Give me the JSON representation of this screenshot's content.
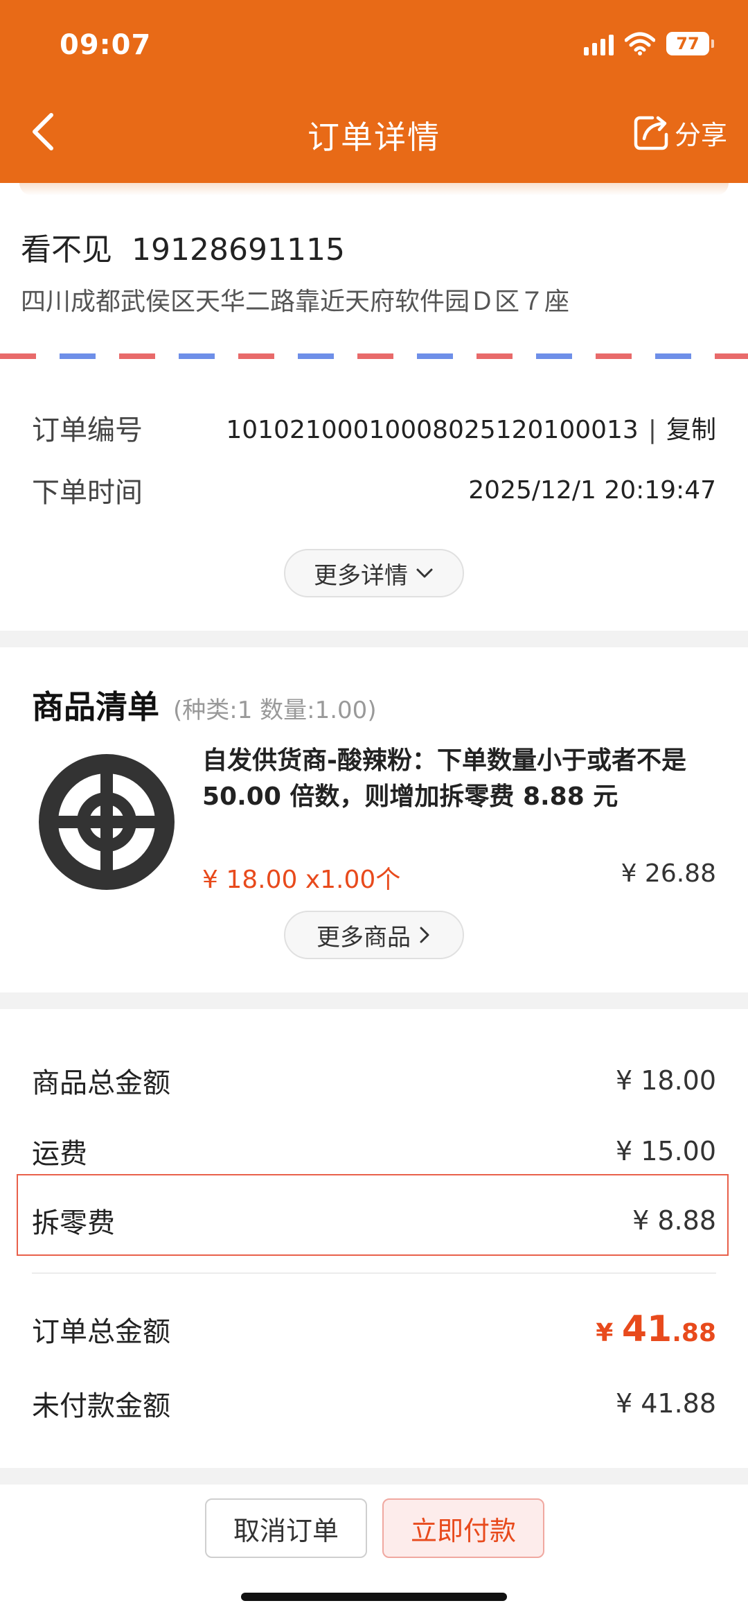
{
  "status": {
    "time": "09:07",
    "battery": "77"
  },
  "header": {
    "title": "订单详情",
    "share_label": "分享"
  },
  "colors": {
    "brand": "#e86a17",
    "accent_red": "#e84a1c"
  },
  "address": {
    "name": "看不见",
    "phone": "19128691115",
    "detail": "四川成都武侯区天华二路靠近天府软件园Ｄ区７座"
  },
  "order": {
    "number_label": "订单编号",
    "number": "1010210001000802512010001З",
    "copy_label": "复制",
    "time_label": "下单时间",
    "time": "2025/12/1 20:19:47",
    "more_details_label": "更多详情"
  },
  "products": {
    "title": "商品清单",
    "summary": "(种类:1  数量:1.00)",
    "items": [
      {
        "name": "自发供货商-酸辣粉：下单数量小于或者不是 50.00 倍数，则增加拆零费 8.88 元",
        "unit_price": "¥ 18.00 x1.00个",
        "total": "¥ 26.88",
        "image_icon": "crosshair-icon"
      }
    ],
    "more_label": "更多商品"
  },
  "amounts": {
    "goods_label": "商品总金额",
    "goods_value": "¥ 18.00",
    "shipping_label": "运费",
    "shipping_value": "¥ 15.00",
    "split_label": "拆零费",
    "split_value": "¥ 8.88",
    "total_label": "订单总金额",
    "total_symbol": "¥",
    "total_int": "41",
    "total_dec": ".88",
    "unpaid_label": "未付款金额",
    "unpaid_value": "¥ 41.88"
  },
  "actions": {
    "cancel_label": "取消订单",
    "pay_label": "立即付款"
  }
}
